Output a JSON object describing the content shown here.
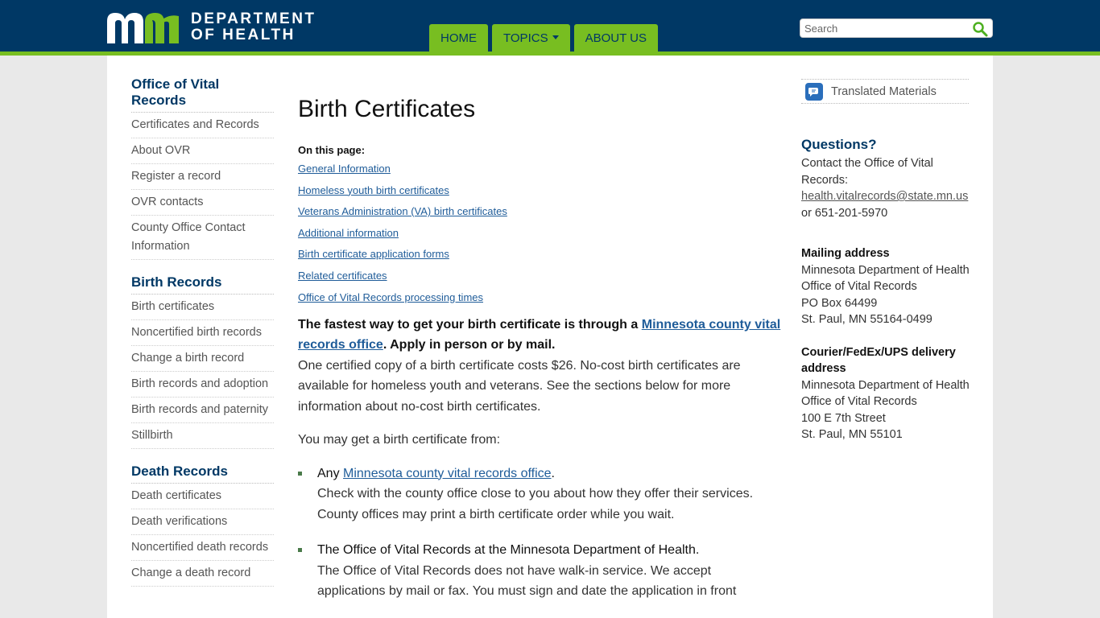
{
  "header": {
    "brand_line1": "DEPARTMENT",
    "brand_line2": "OF HEALTH",
    "nav": [
      {
        "label": "HOME"
      },
      {
        "label": "TOPICS"
      },
      {
        "label": "ABOUT US"
      }
    ],
    "search_placeholder": "Search",
    "search_value": ""
  },
  "sidebar": {
    "groups": [
      {
        "heading": "Office of Vital Records",
        "items": [
          "Certificates and Records",
          "About OVR",
          "Register a record",
          "OVR contacts",
          "County Office Contact Information"
        ]
      },
      {
        "heading": "Birth Records",
        "items": [
          "Birth certificates",
          "Noncertified birth records",
          "Change a birth record",
          "Birth records and adoption",
          "Birth records and paternity",
          "Stillbirth"
        ]
      },
      {
        "heading": "Death Records",
        "items": [
          "Death certificates",
          "Death verifications",
          "Noncertified death records",
          "Change a death record"
        ]
      }
    ]
  },
  "main": {
    "title": "Birth Certificates",
    "on_this_page_label": "On this page:",
    "on_this_page_links": [
      "General Information",
      "Homeless youth birth certificates",
      "Veterans Administration (VA) birth certificates",
      "Additional information",
      "Birth certificate application forms",
      "Related certificates",
      "Office of Vital Records processing times"
    ],
    "lead_pre": "The fastest way to get your birth certificate is through a ",
    "lead_link": "Minnesota county vital records office",
    "lead_post": ". Apply in person or by mail.",
    "cost_text": "One certified copy of a birth certificate costs $26. No-cost birth certificates are available for homeless youth and veterans. See the sections below for more information about no-cost birth certificates.",
    "from_text": "You may get a birth certificate from:",
    "bullets": [
      {
        "pre": "Any ",
        "link": "Minnesota county vital records office",
        "post": ".",
        "desc": "Check with the county office close to you about how they offer their services. County offices may print a birth certificate order while you wait."
      },
      {
        "pre": "The Office of Vital Records at the Minnesota Department of Health.",
        "link": "",
        "post": "",
        "desc": "The Office of Vital Records does not have walk-in service. We accept applications by mail or fax. You must sign and date the application in front"
      }
    ]
  },
  "right": {
    "translated_label": "Translated Materials",
    "questions_heading": "Questions?",
    "contact_text": "Contact the Office of Vital Records:",
    "email": "health.vitalrecords@state.mn.us",
    "phone_text": "or 651-201-5970",
    "mailing_heading": "Mailing address",
    "mailing_lines": [
      "Minnesota Department of Health",
      "Office of Vital Records",
      "PO Box 64499",
      "St. Paul, MN 55164-0499"
    ],
    "courier_heading": "Courier/FedEx/UPS delivery address",
    "courier_lines": [
      "Minnesota Department of Health",
      "Office of Vital Records",
      "100 E 7th Street",
      "St. Paul, MN 55101"
    ]
  },
  "colors": {
    "header_blue": "#003865",
    "accent_green": "#78be21",
    "link_blue": "#1f5c99"
  }
}
